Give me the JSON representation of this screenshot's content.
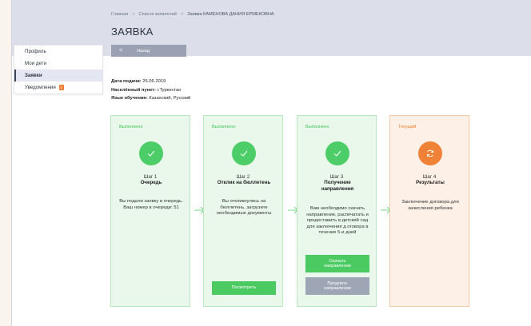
{
  "breadcrumb": {
    "home": "Главная",
    "applications": "Список заявлений",
    "current": "Заявка КАМЕНОВА ДАНИЯ ЕРМЕКОВНА",
    "separator": ">"
  },
  "page": {
    "title": "ЗАЯВКА",
    "back_label": "Назад",
    "back_chevron": "<"
  },
  "sidebar": {
    "items": [
      {
        "label": "Профиль"
      },
      {
        "label": "Мои дети"
      },
      {
        "label": "Заявки"
      },
      {
        "label": "Уведомления",
        "badge": "1"
      }
    ]
  },
  "info": {
    "submit_date_label": "Дата подачи:",
    "submit_date_value": "26.06.2019",
    "locality_label": "Населённый пункт:",
    "locality_value": "г.Туркестан",
    "language_label": "Язык обучения:",
    "language_value": "Казахский, Русский"
  },
  "steps": [
    {
      "status": "Выполнено",
      "number": "Шаг 1",
      "name": "Очередь",
      "description": "Вы подали заявку в очередь. Ваш номер в очереди: 51",
      "icon": "check-icon"
    },
    {
      "status": "Выполнено",
      "number": "Шаг 2",
      "name": "Отклик на бюллетень",
      "description": "Вы откликнулись на бюллетень, загрузите необходимые документы",
      "button": "Посмотреть",
      "icon": "check-icon"
    },
    {
      "status": "Выполнено",
      "number": "Шаг 3",
      "name": "Получение направления",
      "description": "Вам необходимо скачать направление, распечатать и предоставить в детский сад для заключения д оговора в течение 5-и дней",
      "button_download": "Скачать направление",
      "button_extend": "Продлить направление",
      "icon": "check-icon"
    },
    {
      "status": "Текущий",
      "number": "Шаг 4",
      "name": "Результаты",
      "description": "Заключение договора для зачисления ребенка",
      "icon": "refresh-icon"
    }
  ],
  "colors": {
    "done": "#4ccd67",
    "current": "#ef8237",
    "header_bg": "#dcdfe9",
    "button_gray": "#9ea6b6",
    "badge": "#ef7f3a"
  }
}
